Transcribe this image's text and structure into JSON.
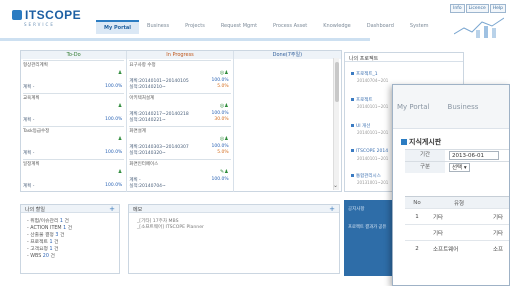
{
  "header": {
    "logo_text": "ITSCOPE",
    "logo_sub": "SERVICE",
    "nav": [
      "My Portal",
      "Business",
      "Projects",
      "Request Mgmt",
      "Process Asset",
      "Knowledge",
      "Dashboard",
      "System"
    ],
    "top_links": [
      "Info",
      "Licence",
      "Help"
    ]
  },
  "kanban": {
    "columns": [
      "To-Do",
      "In Progress",
      "Done(7주일)"
    ],
    "todo": [
      {
        "title": "형상관리계획",
        "plan": "계획 -",
        "pct": "100.0%"
      },
      {
        "title": "교육계획",
        "plan": "계획 -",
        "pct": "100.0%"
      },
      {
        "title": "Task등급수정",
        "plan": "계획 -",
        "pct": "100.0%"
      },
      {
        "title": "일정계획",
        "plan": "계획 -",
        "pct": "100.0%"
      }
    ],
    "progress": [
      {
        "title": "요구사항 수정",
        "plan": "계획:20140101~20140105",
        "actual": "실적:20140210~",
        "pct1": "100.0%",
        "pct2": "5.0%"
      },
      {
        "title": "아키텍처설계",
        "plan": "계획:20140217~20140218",
        "actual": "실적:20140221~",
        "pct1": "100.0%",
        "pct2": "30.0%"
      },
      {
        "title": "화면설계",
        "plan": "계획:20140303~20140307",
        "actual": "실적:20140320~",
        "pct1": "100.0%",
        "pct2": "5.0%"
      },
      {
        "title": "화면인터페이스",
        "plan": "계획 -",
        "actual": "실적:20140704~",
        "pct1": "100.0%",
        "pct2": ""
      }
    ]
  },
  "my_work": {
    "title": "나의 할일",
    "items": [
      {
        "label": "- 위험/이슈관리",
        "count": "1",
        "unit": "건"
      },
      {
        "label": "- ACTION ITEM",
        "count": "1",
        "unit": "건"
      },
      {
        "label": "- 산출물 결정",
        "count": "3",
        "unit": "건"
      },
      {
        "label": "- 프로젝트",
        "count": "1",
        "unit": "건"
      },
      {
        "label": "- 고객요청",
        "count": "1",
        "unit": "건"
      },
      {
        "label": "- WBS",
        "count": "20",
        "unit": "건"
      }
    ]
  },
  "memo": {
    "title": "메모",
    "items": [
      "_[기타] 17주차 MBS",
      "_[소프트웨어] ITSCOPE Planner"
    ]
  },
  "projects": {
    "title": "나의 프로젝트",
    "items": [
      {
        "name": "프로젝트_1",
        "date": "20140704~201"
      },
      {
        "name": "프로젝트",
        "date": "20140101~201"
      },
      {
        "name": "UI 개선",
        "date": "20140101~201"
      },
      {
        "name": "ITSCOPE 2014",
        "date": "20140101~201"
      },
      {
        "name": "통합관리시스",
        "date": "20131001~201"
      }
    ]
  },
  "notice": {
    "title": "공지사항",
    "text": "프로젝트 결과가 공유"
  },
  "popup": {
    "nav": [
      "My Portal",
      "Business"
    ],
    "title": "지식게시판",
    "period_label": "기간",
    "period_value": "2013-06-01",
    "type_label": "구분",
    "type_value": "선택",
    "col_no": "No",
    "col_type": "유형",
    "rows": [
      {
        "no": "1",
        "type": "기타",
        "extra": "기타"
      },
      {
        "no": "",
        "type": "기타",
        "extra": "기타"
      },
      {
        "no": "2",
        "type": "소프트웨어",
        "extra": "소프"
      }
    ]
  }
}
